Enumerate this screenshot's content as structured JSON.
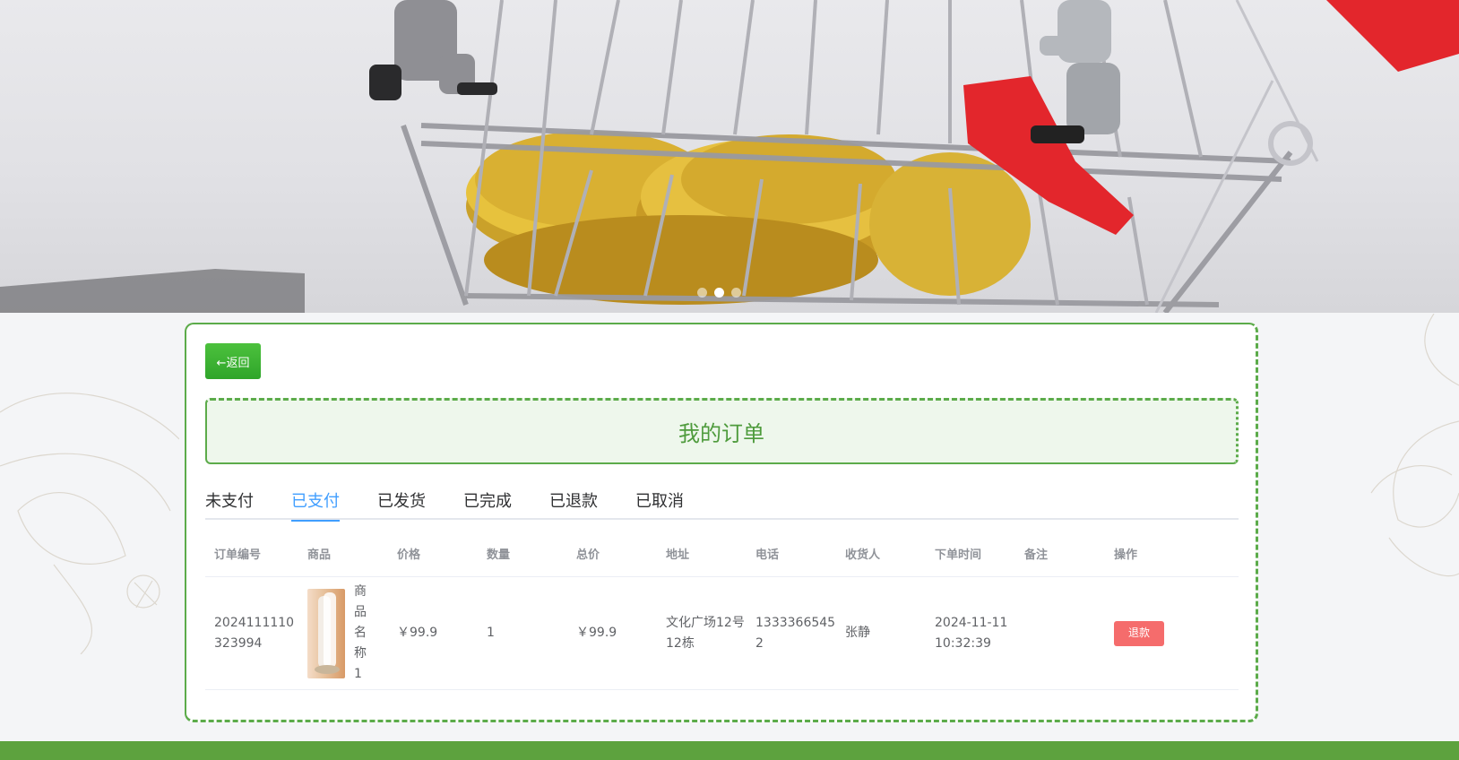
{
  "banner": {
    "slides": 3,
    "active_slide": 2
  },
  "back_button": {
    "label": "←返回"
  },
  "page_title": "我的订单",
  "tabs": [
    {
      "label": "未支付",
      "active": false
    },
    {
      "label": "已支付",
      "active": true
    },
    {
      "label": "已发货",
      "active": false
    },
    {
      "label": "已完成",
      "active": false
    },
    {
      "label": "已退款",
      "active": false
    },
    {
      "label": "已取消",
      "active": false
    }
  ],
  "table": {
    "headers": [
      "订单编号",
      "商品",
      "价格",
      "数量",
      "总价",
      "地址",
      "电话",
      "收货人",
      "下单时间",
      "备注",
      "操作"
    ],
    "rows": [
      {
        "order_no": "2024111110323994",
        "product_name": "商品名称1",
        "price": "￥99.9",
        "quantity": "1",
        "total": "￥99.9",
        "address": "文化广场12号12栋",
        "phone": "13333665452",
        "receiver": "张静",
        "order_time": "2024-11-11 10:32:39",
        "remark": "",
        "action_label": "退款"
      }
    ]
  },
  "colors": {
    "theme_green": "#5cab4a",
    "active_tab": "#409eff",
    "refund": "#f56c6c"
  }
}
